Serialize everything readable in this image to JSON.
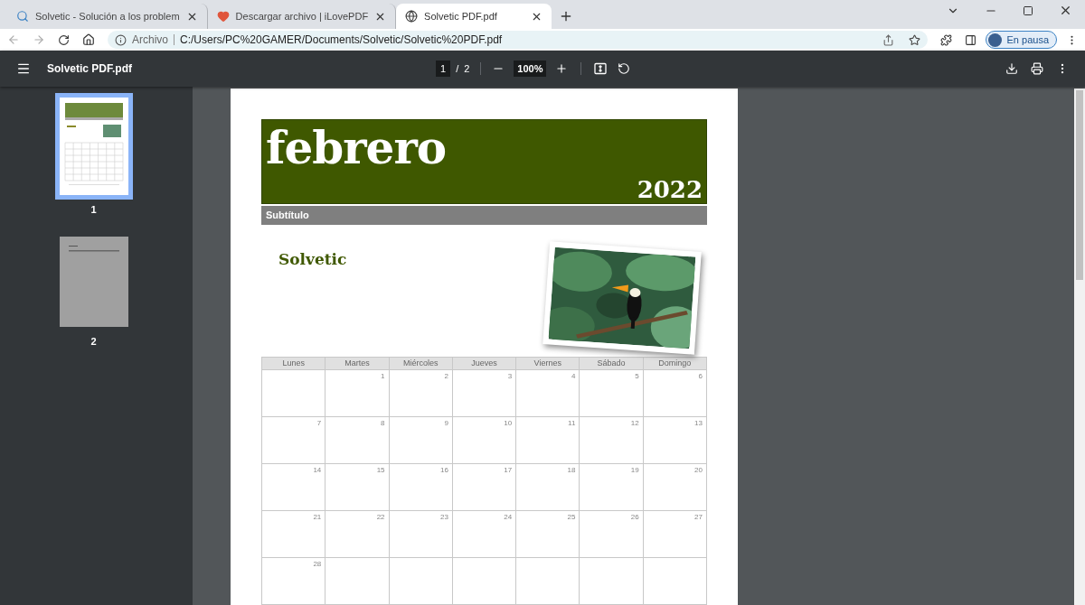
{
  "tabs": [
    {
      "title": "Solvetic - Solución a los problem",
      "selected": false
    },
    {
      "title": "Descargar archivo | iLovePDF",
      "selected": false
    },
    {
      "title": "Solvetic PDF.pdf",
      "selected": true
    }
  ],
  "address_bar": {
    "scheme_label": "Archivo",
    "url": "C:/Users/PC%20GAMER/Documents/Solvetic/Solvetic%20PDF.pdf",
    "profile_label": "En pausa"
  },
  "pdf_toolbar": {
    "title": "Solvetic PDF.pdf",
    "page": "1",
    "separator": "/",
    "total_pages": "2",
    "zoom": "100%"
  },
  "thumbnails": [
    {
      "label": "1",
      "kind": "calendar",
      "selected": true
    },
    {
      "label": "2",
      "kind": "text",
      "selected": false
    }
  ],
  "document": {
    "month": "febrero",
    "year": "2022",
    "subtitle": "Subtítulo",
    "heading": "Solvetic",
    "calendar": {
      "columns": [
        "Lunes",
        "Martes",
        "Miércoles",
        "Jueves",
        "Viernes",
        "Sábado",
        "Domingo"
      ],
      "weeks": [
        [
          {
            "kind": "blank"
          },
          {
            "kind": "day",
            "day": "1"
          },
          {
            "kind": "day",
            "day": "2"
          },
          {
            "kind": "day",
            "day": "3"
          },
          {
            "kind": "day",
            "day": "4"
          },
          {
            "kind": "day",
            "day": "5"
          },
          {
            "kind": "day",
            "day": "6"
          }
        ],
        [
          {
            "kind": "day",
            "day": "7"
          },
          {
            "kind": "day",
            "day": "8"
          },
          {
            "kind": "day",
            "day": "9"
          },
          {
            "kind": "day",
            "day": "10"
          },
          {
            "kind": "day",
            "day": "11"
          },
          {
            "kind": "day",
            "day": "12"
          },
          {
            "kind": "day",
            "day": "13"
          }
        ],
        [
          {
            "kind": "day",
            "day": "14"
          },
          {
            "kind": "day",
            "day": "15"
          },
          {
            "kind": "day",
            "day": "16"
          },
          {
            "kind": "day",
            "day": "17"
          },
          {
            "kind": "day",
            "day": "18"
          },
          {
            "kind": "day",
            "day": "19"
          },
          {
            "kind": "day",
            "day": "20"
          }
        ],
        [
          {
            "kind": "day",
            "day": "21"
          },
          {
            "kind": "day",
            "day": "22"
          },
          {
            "kind": "day",
            "day": "23"
          },
          {
            "kind": "day",
            "day": "24"
          },
          {
            "kind": "day",
            "day": "25"
          },
          {
            "kind": "day",
            "day": "26"
          },
          {
            "kind": "day",
            "day": "27"
          }
        ],
        [
          {
            "kind": "day",
            "day": "28"
          },
          {
            "kind": "blank"
          },
          {
            "kind": "blank"
          },
          {
            "kind": "blank"
          },
          {
            "kind": "blank"
          },
          {
            "kind": "blank"
          },
          {
            "kind": "blank"
          }
        ]
      ]
    }
  }
}
